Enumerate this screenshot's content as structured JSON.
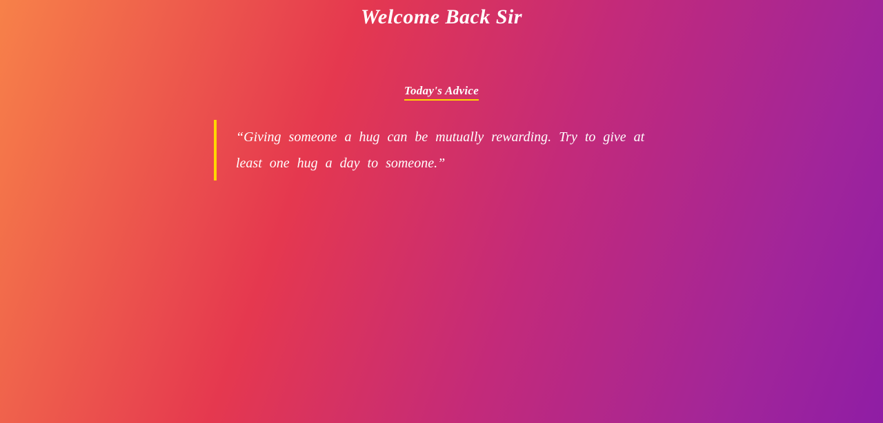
{
  "header": {
    "title": "Welcome Back Sir"
  },
  "advice": {
    "heading": "Today's Advice",
    "quote": "Giving someone a hug can be mutually rewarding. Try to give at least one hug a day to someone."
  }
}
